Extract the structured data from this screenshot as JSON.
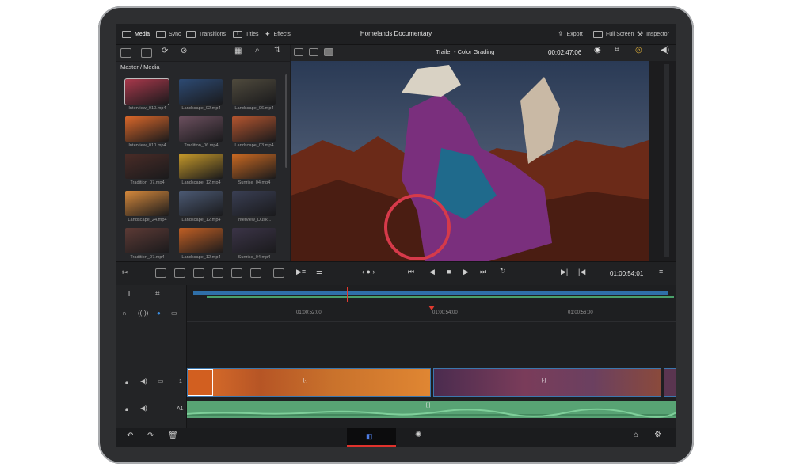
{
  "project_title": "Homelands Documentary",
  "pages_left": [
    {
      "label": "Media",
      "icon": "media-icon"
    },
    {
      "label": "Sync",
      "icon": "sync-icon"
    },
    {
      "label": "Transitions",
      "icon": "transitions-icon"
    },
    {
      "label": "Titles",
      "icon": "titles-icon"
    },
    {
      "label": "Effects",
      "icon": "effects-icon"
    }
  ],
  "pages_right": [
    {
      "label": "Export",
      "icon": "export-icon"
    },
    {
      "label": "Full Screen",
      "icon": "fullscreen-icon"
    },
    {
      "label": "Inspector",
      "icon": "inspector-icon"
    }
  ],
  "media": {
    "breadcrumb": "Master / Media",
    "clips": [
      {
        "label": "Interview_010.mp4",
        "color": "#a8384b",
        "selected": true
      },
      {
        "label": "Landscape_02.mp4",
        "color": "#2d4a73"
      },
      {
        "label": "Landscape_06.mp4",
        "color": "#4f4a3d"
      },
      {
        "label": "Interview_010.mp4",
        "color": "#d9672a"
      },
      {
        "label": "Tradition_06.mp4",
        "color": "#6b4f5e"
      },
      {
        "label": "Landscape_03.mp4",
        "color": "#b4552f"
      },
      {
        "label": "Tradition_07.mp4",
        "color": "#4a2c27"
      },
      {
        "label": "Landscape_12.mp4",
        "color": "#c79a2a"
      },
      {
        "label": "Sunrise_04.mp4",
        "color": "#cc6a22"
      },
      {
        "label": "Landscape_24.mp4",
        "color": "#d6893c"
      },
      {
        "label": "Landscape_12.mp4",
        "color": "#4c5a74"
      },
      {
        "label": "Interview_Dusk...",
        "color": "#3a3f54"
      },
      {
        "label": "Tradition_07.mp4",
        "color": "#5c3a35"
      },
      {
        "label": "Landscape_12.mp4",
        "color": "#c15f24"
      },
      {
        "label": "Sunrise_04.mp4",
        "color": "#3b3447"
      }
    ]
  },
  "viewer": {
    "title": "Trailer - Color Grading",
    "timecode": "00:02:47:06"
  },
  "transport": {
    "timecode": "01:00:54:01"
  },
  "timeline": {
    "ruler_ticks": [
      "01:00:52:00",
      "01:00:54:00",
      "01:00:56:00"
    ],
    "video_track_label": "1",
    "audio_track_label": "A1",
    "clip_marker": "[·]"
  },
  "colors": {
    "accent_red": "#e0322c",
    "audio_green": "#58a374",
    "clip_blue": "#2b5580",
    "background": "#1c1c1e"
  }
}
